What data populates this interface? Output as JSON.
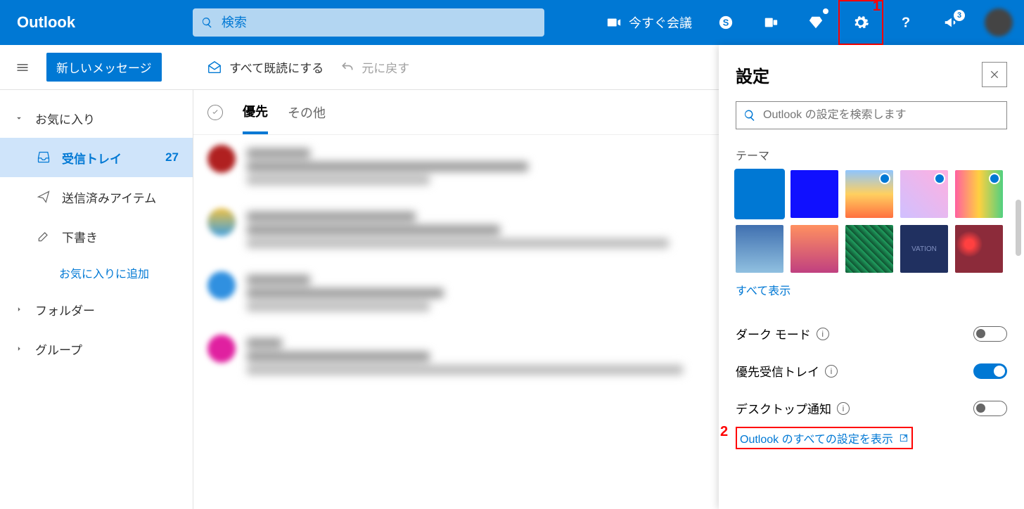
{
  "header": {
    "logo": "Outlook",
    "search_placeholder": "検索",
    "meet_now": "今すぐ会議",
    "notification_badge": "3"
  },
  "toolbar": {
    "new_message": "新しいメッセージ",
    "mark_all_read": "すべて既読にする",
    "undo": "元に戻す"
  },
  "sidebar": {
    "favorites": "お気に入り",
    "inbox": "受信トレイ",
    "inbox_count": "27",
    "sent": "送信済みアイテム",
    "drafts": "下書き",
    "add_favorite": "お気に入りに追加",
    "folders": "フォルダー",
    "groups": "グループ"
  },
  "tabs": {
    "focused": "優先",
    "other": "その他"
  },
  "settings": {
    "title": "設定",
    "search_placeholder": "Outlook の設定を検索します",
    "theme_label": "テーマ",
    "show_all": "すべて表示",
    "dark_mode": "ダーク モード",
    "focused_inbox": "優先受信トレイ",
    "desktop_notifications": "デスクトップ通知",
    "all_settings": "Outlook のすべての設定を表示"
  },
  "annotations": {
    "one": "1",
    "two": "2"
  }
}
